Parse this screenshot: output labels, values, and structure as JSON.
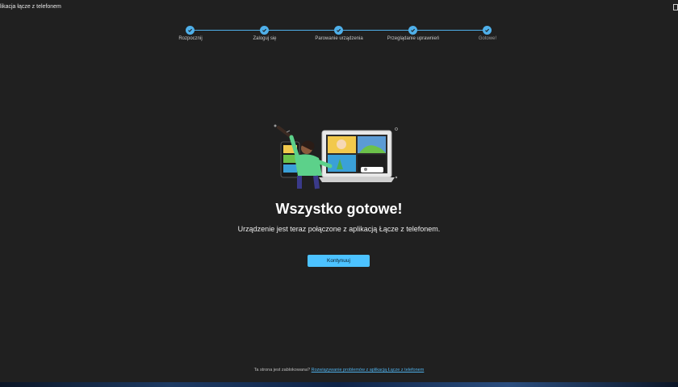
{
  "window": {
    "title": "likacja łącze z telefonem"
  },
  "stepper": {
    "steps": [
      {
        "label": "Rozpocznij",
        "state": "done"
      },
      {
        "label": "Zaloguj się",
        "state": "done"
      },
      {
        "label": "Parowanie urządzenia",
        "state": "done"
      },
      {
        "label": "Przeglądanie uprawnień",
        "state": "done"
      },
      {
        "label": "Gotowe!",
        "state": "current"
      }
    ],
    "accent_color": "#4fb0ea"
  },
  "illustration": {
    "icon": "person-phone-laptop-illustration"
  },
  "main": {
    "heading": "Wszystko gotowe!",
    "subtext": "Urządzenie jest teraz połączone z aplikacją Łącze z telefonem.",
    "continue_label": "Kontynuuj"
  },
  "footer": {
    "prefix": "Ta strona jest zablokowana?",
    "link_text": "Rozwiązywanie problemów z aplikacją Łącze z telefonem"
  },
  "colors": {
    "background": "#202020",
    "button": "#4cc2ff"
  }
}
